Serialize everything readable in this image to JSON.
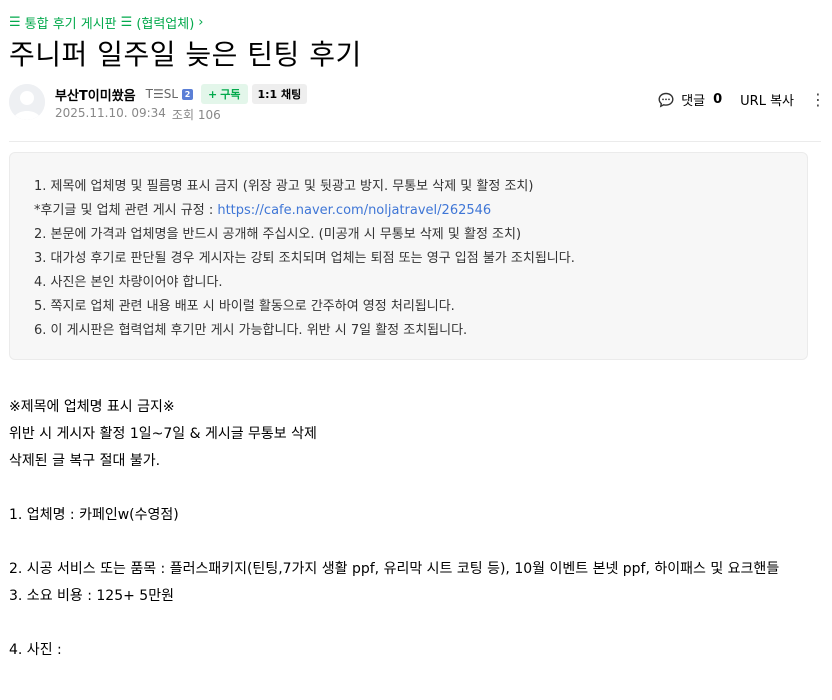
{
  "breadcrumb": {
    "icon": "menu-icon",
    "board": "통합 후기 게시판",
    "sub_icon": "menu-icon",
    "sub": "(협력업체)",
    "arrow": "›"
  },
  "post": {
    "title": "주니퍼 일주일 늦은 틴팅 후기"
  },
  "author": {
    "nickname": "부산T이미쐈음",
    "rank": "T☰SL",
    "grade_badge": "2",
    "subscribe_label": "구독",
    "subscribe_plus": "+",
    "chat_label": "1:1 채팅",
    "date": "2025.11.10. 09:34",
    "views": "조회 106"
  },
  "actions": {
    "comment_label": "댓글",
    "comment_count": "0",
    "url_copy_label": "URL 복사",
    "more_icon": "kebab-menu-icon"
  },
  "notice": {
    "line1": "1. 제목에 업체명 및 필름명 표시 금지 (위장 광고 및 뒷광고 방지. 무통보 삭제 및 활정 조치)",
    "line2_prefix": "*후기글 및 업체 관련 게시 규정 : ",
    "line2_link": "https://cafe.naver.com/noljatravel/262546",
    "line3": "2. 본문에 가격과 업체명을 반드시 공개해 주십시오. (미공개 시 무통보 삭제 및 활정 조치)",
    "line4": "3. 대가성 후기로 판단될 경우 게시자는 강퇴 조치되며 업체는 퇴점 또는 영구 입점 불가 조치됩니다.",
    "line5": "4. 사진은 본인 차량이어야 합니다.",
    "line6": "5. 쪽지로 업체 관련 내용 배포 시 바이럴 활동으로 간주하여 영정 처리됩니다.",
    "line7": "6. 이 게시판은 협력업체 후기만 게시 가능합니다. 위반 시 7일 활정 조치됩니다."
  },
  "body": {
    "warn1": "※제목에 업체명 표시 금지※",
    "warn2": "위반 시 게시자 활정 1일~7일 & 게시글 무통보 삭제",
    "warn3": "삭제된 글 복구 절대 불가.",
    "item1": "1. 업체명 :  카페인w(수영점)",
    "item2": "2. 시공 서비스 또는 품목 :  플러스패키지(틴팅,7가지 생활 ppf, 유리막 시트 코팅 등), 10월 이벤트 본넷 ppf, 하이패스 및 요크핸들",
    "item3": "3. 소요 비용 :  125+ 5만원",
    "item4": "4. 사진 :"
  }
}
